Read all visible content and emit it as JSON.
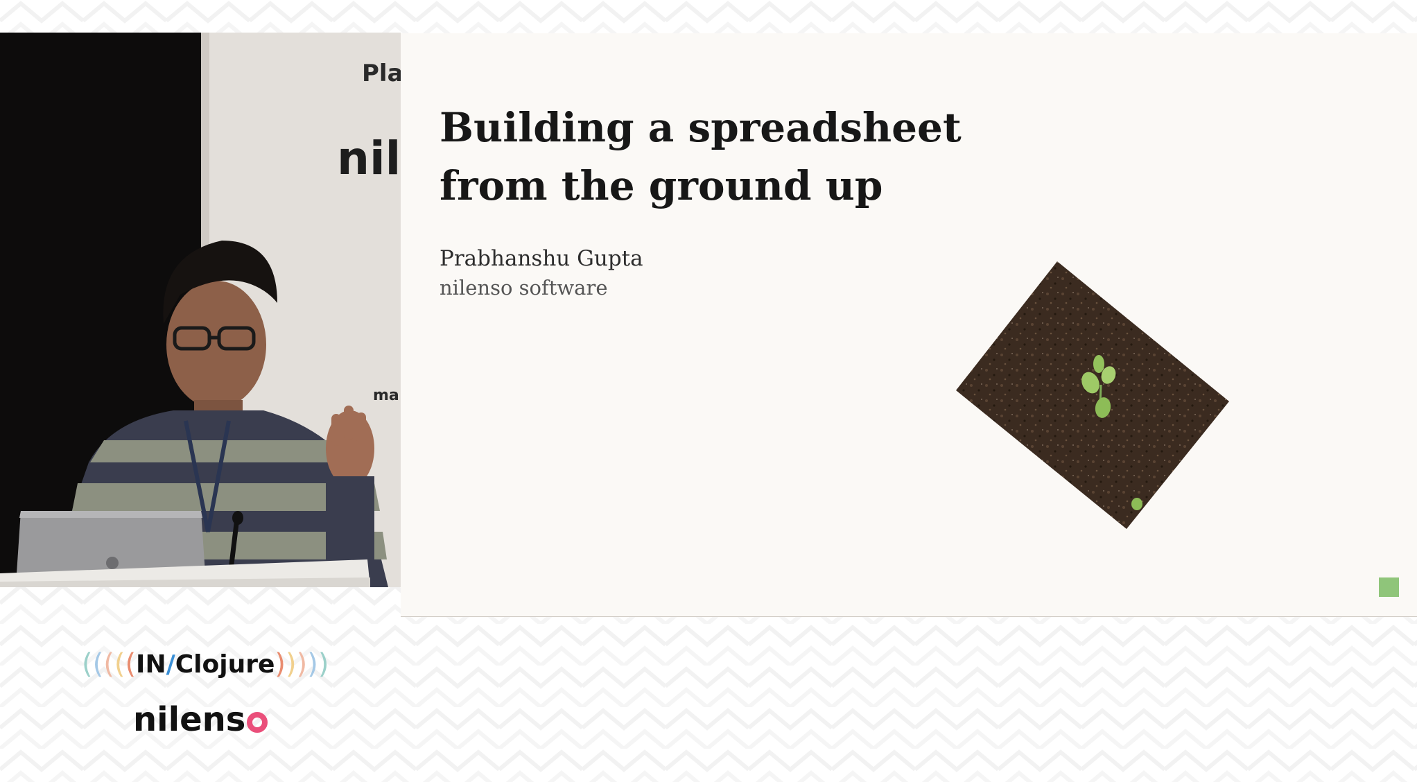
{
  "slide": {
    "title_line1": "Building a spreadsheet",
    "title_line2": "from the ground up",
    "author": "Prabhanshu Gupta",
    "company": "nilenso software",
    "accent_color": "#8fc57a"
  },
  "camera": {
    "backdrop_text_top": "Pla",
    "backdrop_text_logo": "nil",
    "backdrop_text_small": "ma"
  },
  "branding": {
    "conference_left": "IN",
    "conference_slash": "/",
    "conference_right": "Clojure",
    "sponsor_text": "nilens",
    "paren_colors": [
      "#9bd0c9",
      "#a4c8e6",
      "#f0b9a3",
      "#f1d08d",
      "#e98c6f"
    ],
    "sponsor_accent": "#ea4f7a"
  }
}
